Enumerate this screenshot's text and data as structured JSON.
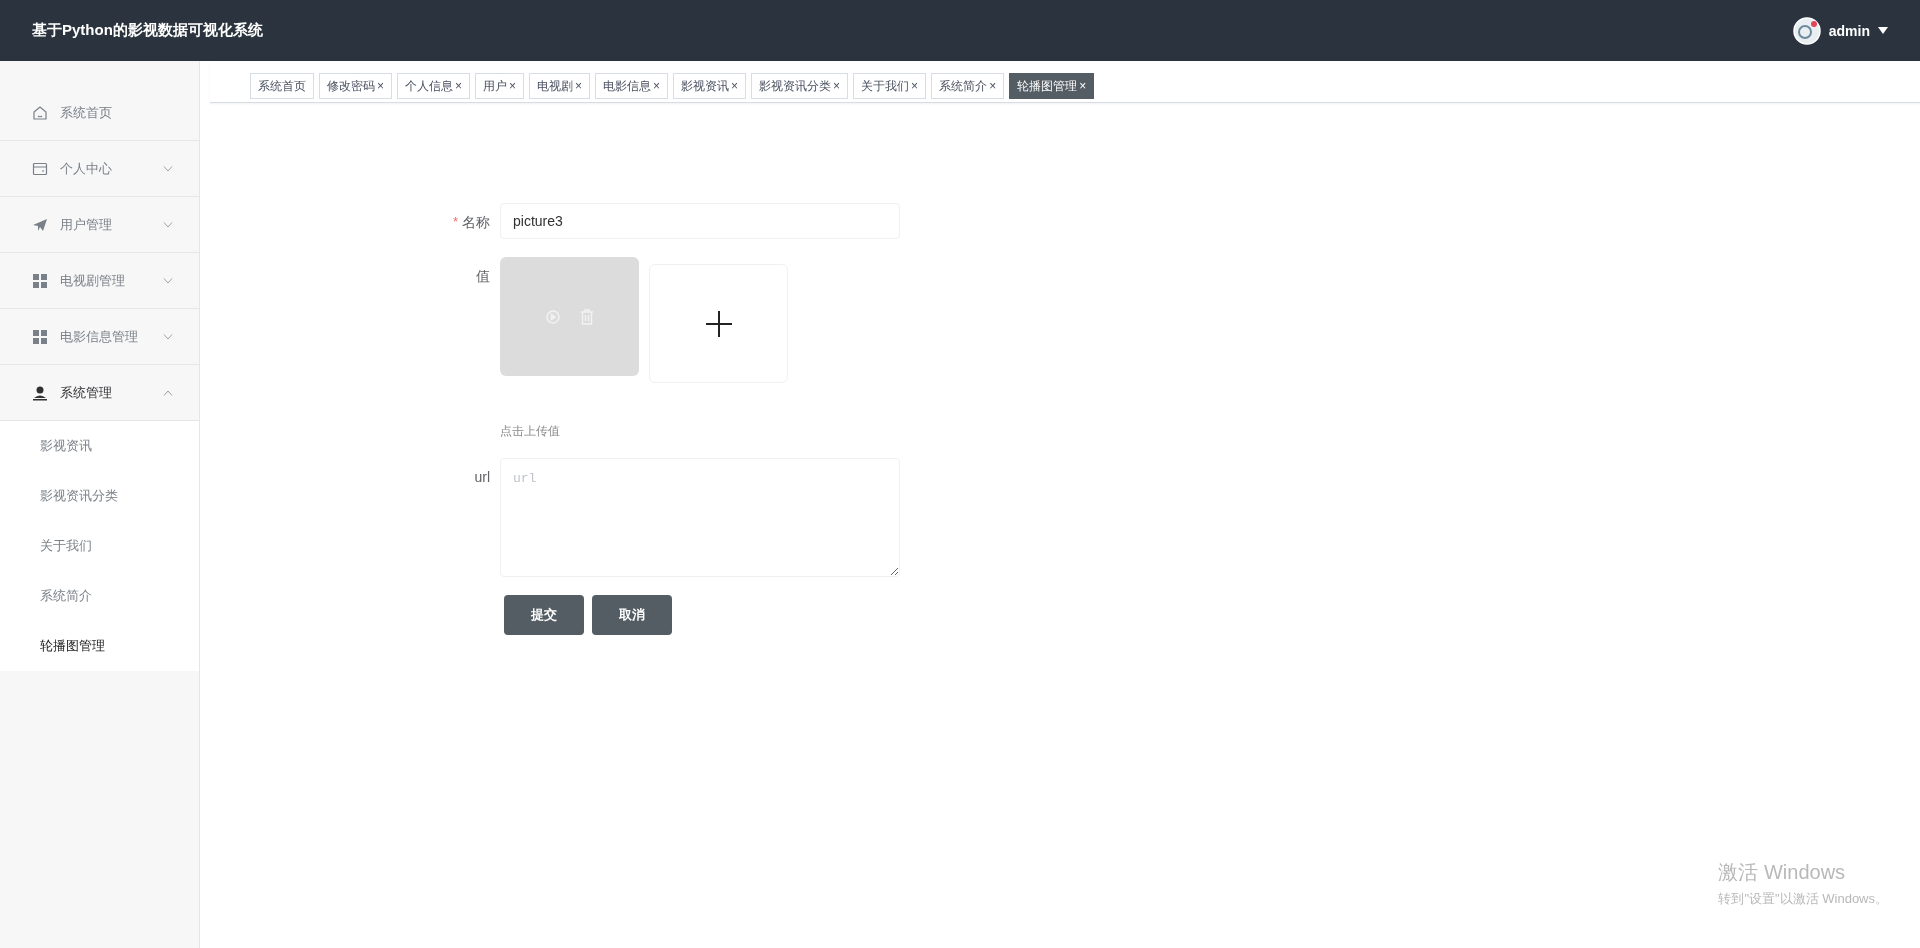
{
  "header": {
    "title": "基于Python的影视数据可视化系统",
    "user": {
      "name": "admin"
    }
  },
  "sidebar": {
    "items": [
      {
        "label": "系统首页"
      },
      {
        "label": "个人中心",
        "expanded": false
      },
      {
        "label": "用户管理",
        "expanded": false
      },
      {
        "label": "电视剧管理",
        "expanded": false
      },
      {
        "label": "电影信息管理",
        "expanded": false
      },
      {
        "label": "系统管理",
        "expanded": true,
        "children": [
          {
            "label": "影视资讯",
            "selected": false
          },
          {
            "label": "影视资讯分类",
            "selected": false
          },
          {
            "label": "关于我们",
            "selected": false
          },
          {
            "label": "系统简介",
            "selected": false
          },
          {
            "label": "轮播图管理",
            "selected": true
          }
        ]
      }
    ]
  },
  "tabs": [
    {
      "label": "系统首页",
      "selected": false
    },
    {
      "label": "修改密码",
      "close": "×",
      "selected": false
    },
    {
      "label": "个人信息",
      "close": "×",
      "selected": false
    },
    {
      "label": "用户",
      "close": "×",
      "selected": false
    },
    {
      "label": "电视剧",
      "close": "×",
      "selected": false
    },
    {
      "label": "电影信息",
      "close": "×",
      "selected": false
    },
    {
      "label": "影视资讯",
      "close": "×",
      "selected": false
    },
    {
      "label": "影视资讯分类",
      "close": "×",
      "selected": false
    },
    {
      "label": "关于我们",
      "close": "×",
      "selected": false
    },
    {
      "label": "系统简介",
      "close": "×",
      "selected": false
    },
    {
      "label": "轮播图管理",
      "close": "×",
      "selected": true
    }
  ],
  "form": {
    "fields": [
      {
        "kind": "text",
        "required_mark": "*",
        "label": "名称",
        "value": "picture3"
      },
      {
        "kind": "upload",
        "label": "值",
        "hint": "点击上传值"
      },
      {
        "kind": "textarea",
        "label": "url",
        "placeholder": "url"
      }
    ],
    "buttons": [
      "提交",
      "取消"
    ]
  },
  "os_notice": {
    "title": "激活 Windows",
    "subtitle": "转到\"设置\"以激活 Windows。"
  }
}
